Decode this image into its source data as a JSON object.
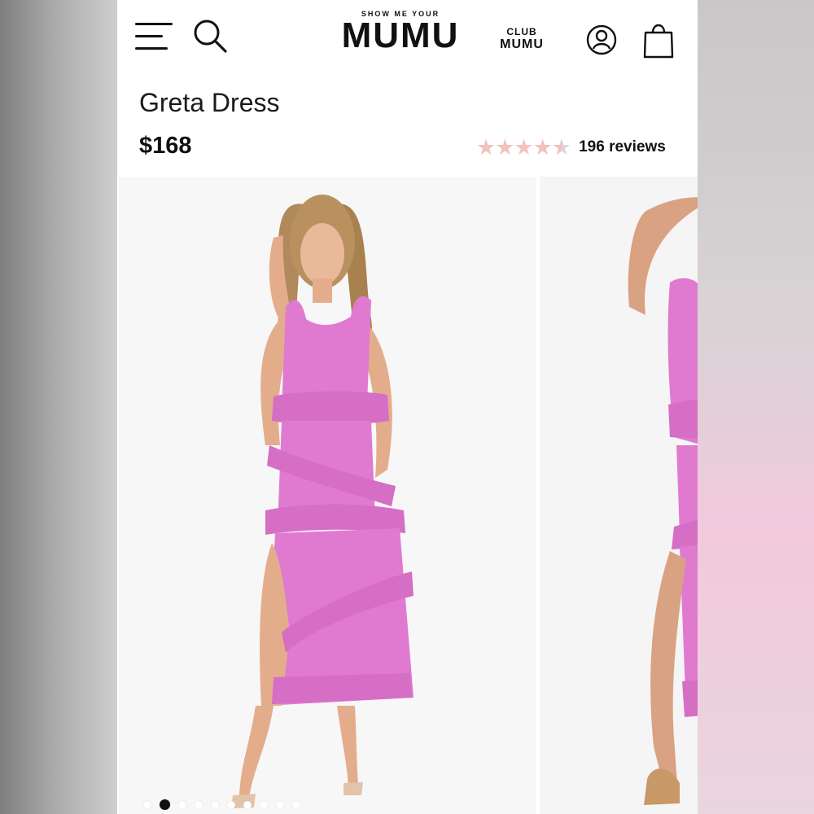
{
  "header": {
    "logo_top": "SHOW ME YOUR",
    "logo_main": "MUMU",
    "club_top": "CLUB",
    "club_main": "MUMU",
    "icons": [
      "menu-icon",
      "search-icon",
      "account-icon",
      "bag-icon"
    ]
  },
  "product": {
    "title": "Greta Dress",
    "price": "$168",
    "rating": 4.5,
    "reviews_label": "196 reviews"
  },
  "carousel": {
    "slide_count": 10,
    "active_index": 1
  },
  "colors": {
    "accent_star": "#f3c2bd",
    "dress_pink": "#e07ad0",
    "text": "#111111"
  }
}
